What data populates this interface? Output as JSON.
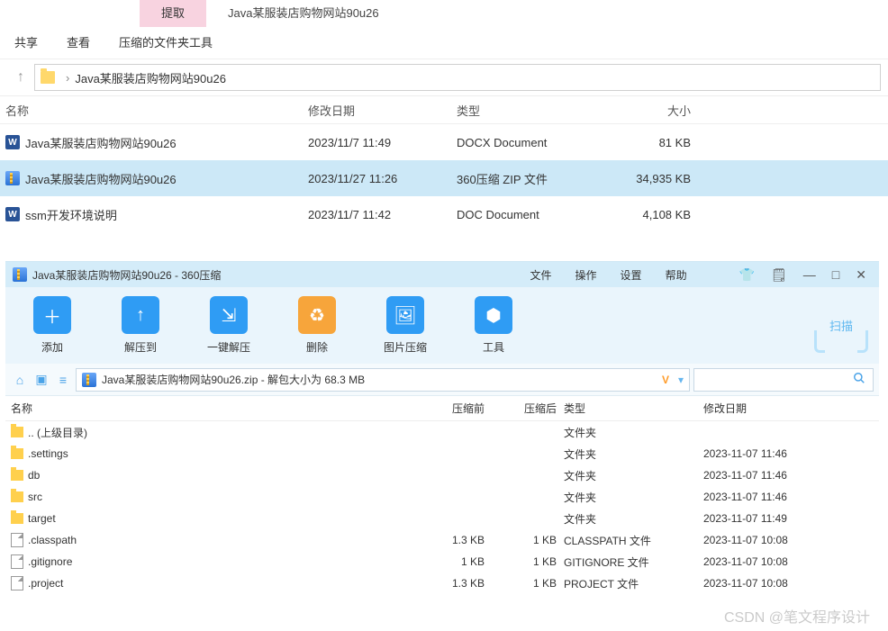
{
  "tabs": {
    "extract": "提取",
    "title": "Java某服装店购物网站90u26"
  },
  "menu": {
    "share": "共享",
    "view": "查看",
    "ziptool": "压缩的文件夹工具"
  },
  "breadcrumb": {
    "path": "Java某服装店购物网站90u26"
  },
  "explorer": {
    "headers": {
      "name": "名称",
      "date": "修改日期",
      "type": "类型",
      "size": "大小"
    },
    "rows": [
      {
        "name": "Java某服装店购物网站90u26",
        "date": "2023/11/7 11:49",
        "type": "DOCX Document",
        "size": "81 KB",
        "icon": "w"
      },
      {
        "name": "Java某服装店购物网站90u26",
        "date": "2023/11/27 11:26",
        "type": "360压缩 ZIP 文件",
        "size": "34,935 KB",
        "icon": "z",
        "selected": true
      },
      {
        "name": "ssm开发环境说明",
        "date": "2023/11/7 11:42",
        "type": "DOC Document",
        "size": "4,108 KB",
        "icon": "w"
      }
    ]
  },
  "zipwin": {
    "title": "Java某服装店购物网站90u26 - 360压缩",
    "menus": {
      "file": "文件",
      "ops": "操作",
      "settings": "设置",
      "help": "帮助"
    },
    "toolbar": {
      "add": "添加",
      "extractTo": "解压到",
      "oneClick": "一键解压",
      "delete": "删除",
      "imgCompress": "图片压缩",
      "tools": "工具",
      "scan": "扫描"
    },
    "address": "Java某服装店购物网站90u26.zip - 解包大小为 68.3 MB",
    "vlabel": "V",
    "listHeaders": {
      "name": "名称",
      "before": "压缩前",
      "after": "压缩后",
      "type": "类型",
      "date": "修改日期"
    },
    "rows": [
      {
        "name": ".. (上级目录)",
        "before": "",
        "after": "",
        "type": "文件夹",
        "date": "",
        "icon": "folder"
      },
      {
        "name": ".settings",
        "before": "",
        "after": "",
        "type": "文件夹",
        "date": "2023-11-07 11:46",
        "icon": "folder"
      },
      {
        "name": "db",
        "before": "",
        "after": "",
        "type": "文件夹",
        "date": "2023-11-07 11:46",
        "icon": "folder"
      },
      {
        "name": "src",
        "before": "",
        "after": "",
        "type": "文件夹",
        "date": "2023-11-07 11:46",
        "icon": "folder"
      },
      {
        "name": "target",
        "before": "",
        "after": "",
        "type": "文件夹",
        "date": "2023-11-07 11:49",
        "icon": "folder"
      },
      {
        "name": ".classpath",
        "before": "1.3 KB",
        "after": "1 KB",
        "type": "CLASSPATH 文件",
        "date": "2023-11-07 10:08",
        "icon": "doc"
      },
      {
        "name": ".gitignore",
        "before": "1 KB",
        "after": "1 KB",
        "type": "GITIGNORE 文件",
        "date": "2023-11-07 10:08",
        "icon": "doc"
      },
      {
        "name": ".project",
        "before": "1.3 KB",
        "after": "1 KB",
        "type": "PROJECT 文件",
        "date": "2023-11-07 10:08",
        "icon": "doc"
      }
    ]
  },
  "watermark": "CSDN @笔文程序设计"
}
